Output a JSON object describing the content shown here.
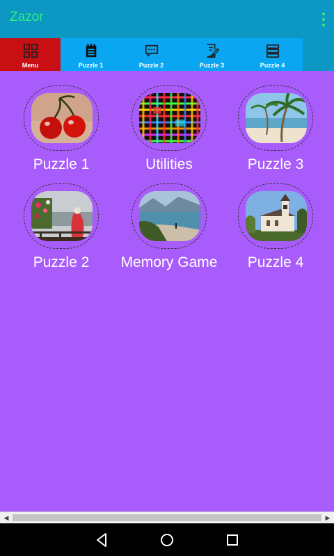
{
  "app": {
    "title": "Zazor"
  },
  "tabs": [
    {
      "label": "Menu",
      "icon": "grid-icon",
      "active": true
    },
    {
      "label": "Puzzle 1",
      "icon": "notepad-icon",
      "active": false
    },
    {
      "label": "Puzzle 2",
      "icon": "chat-icon",
      "active": false
    },
    {
      "label": "Puzzle 3",
      "icon": "edit-note-icon",
      "active": false
    },
    {
      "label": "Puzzle 4",
      "icon": "stack-icon",
      "active": false
    }
  ],
  "tiles": [
    {
      "label": "Puzzle 1",
      "image": "cherries"
    },
    {
      "label": "Utilities",
      "image": "colorful-grid"
    },
    {
      "label": "Puzzle 3",
      "image": "palm-beach"
    },
    {
      "label": "Puzzle 2",
      "image": "flower-balcony"
    },
    {
      "label": "Memory Game",
      "image": "lake-shore"
    },
    {
      "label": "Puzzle 4",
      "image": "chapel"
    }
  ],
  "colors": {
    "appbar": "#0d97c3",
    "title": "#2ef07a",
    "tab": "#0aa6f1",
    "tab_active": "#c80f14",
    "content": "#a85cfb"
  }
}
